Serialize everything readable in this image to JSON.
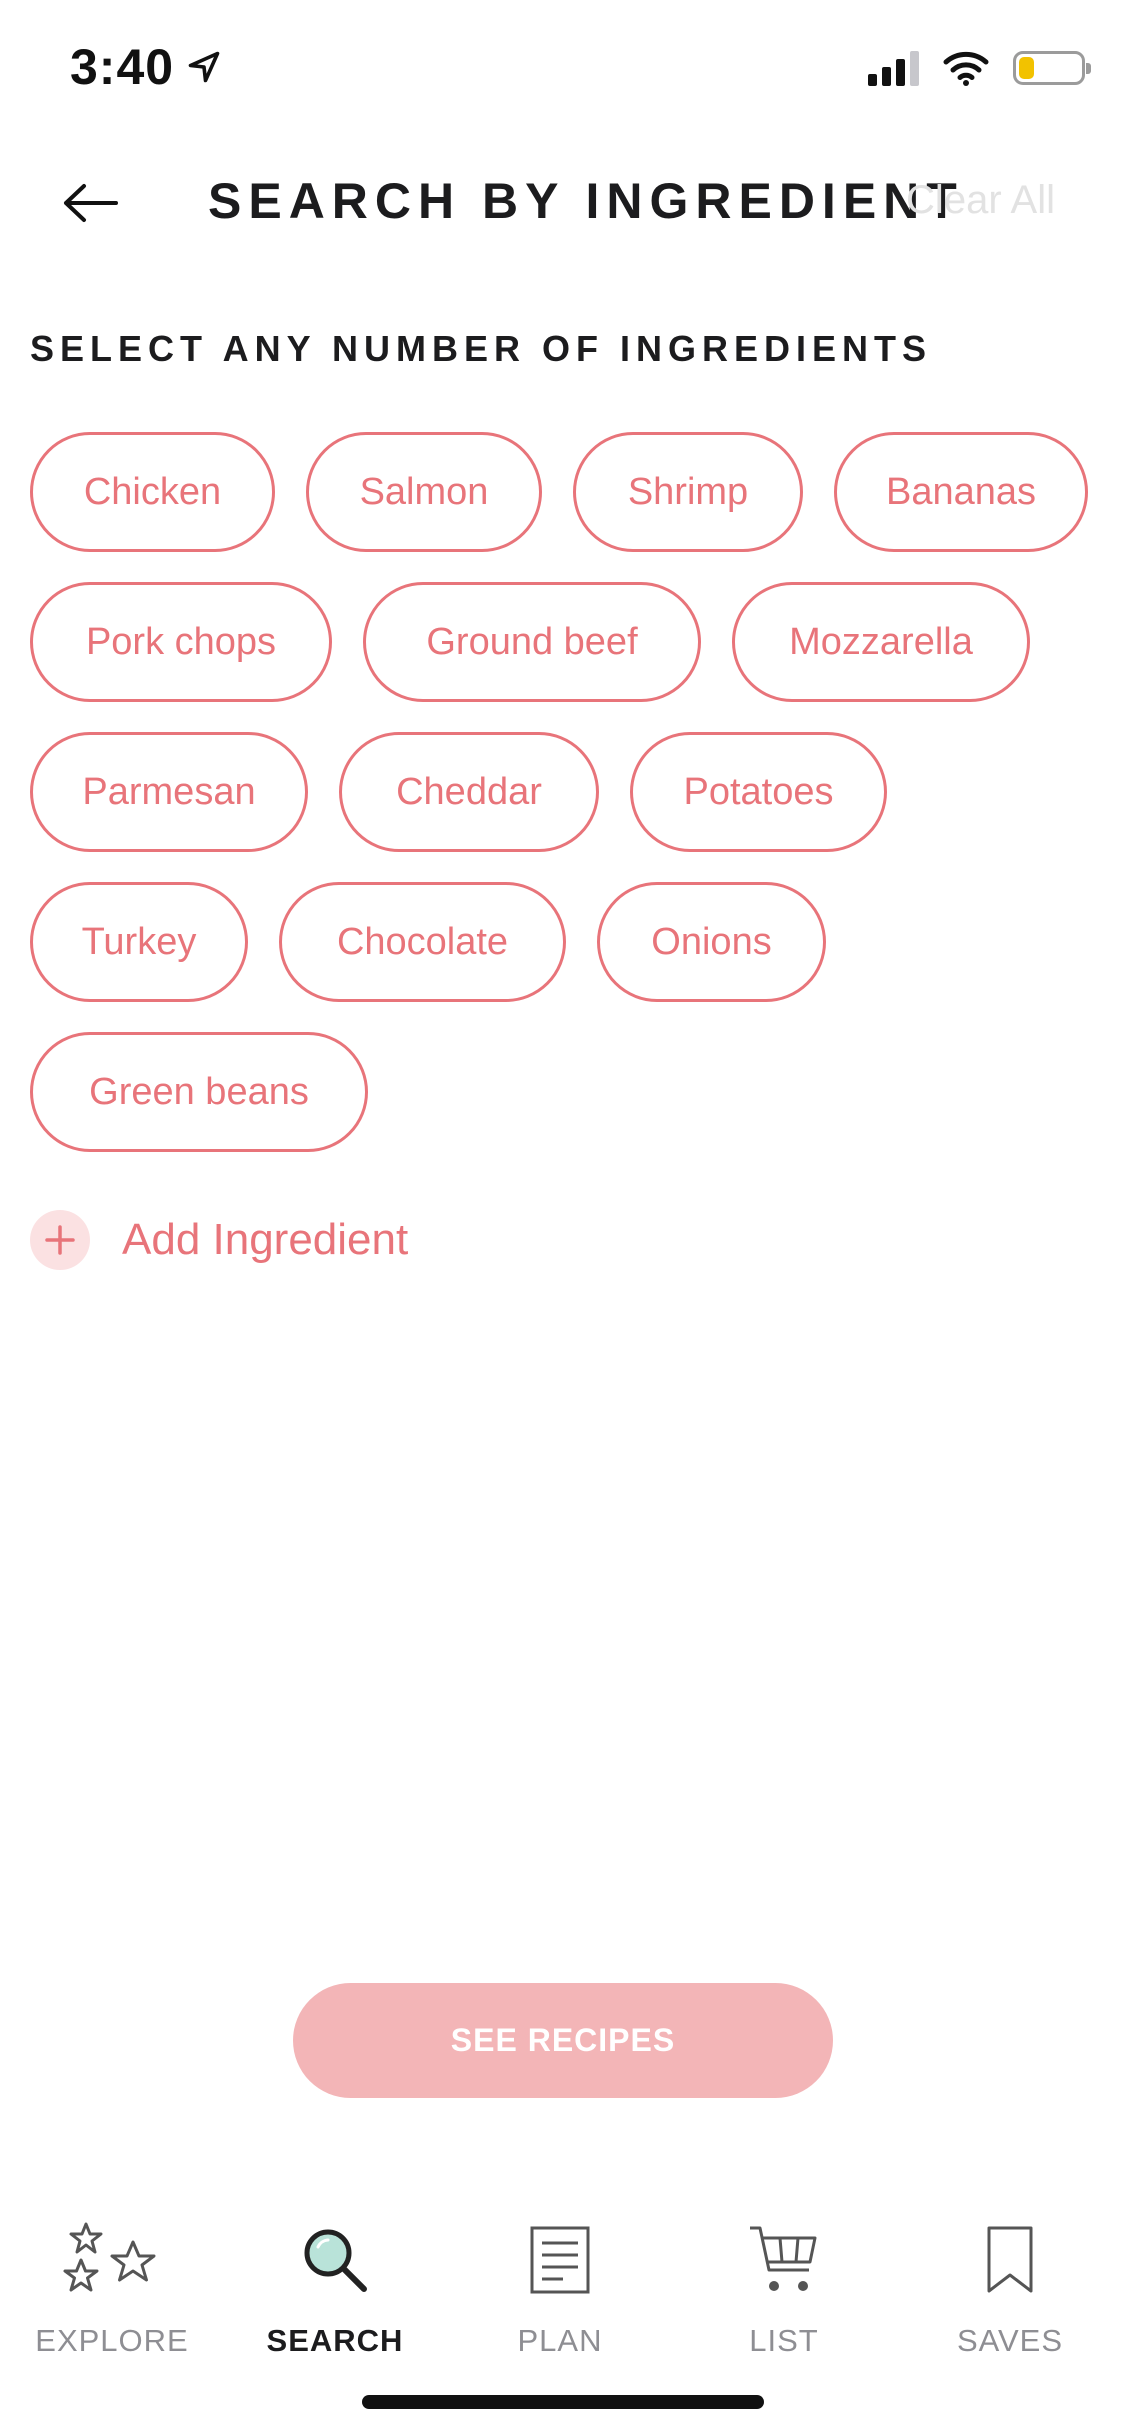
{
  "status_bar": {
    "time": "3:40",
    "battery_level": 0.25,
    "signal_bars": 4,
    "signal_bars_active": 3
  },
  "header": {
    "title": "SEARCH BY INGREDIENT",
    "clear_all": "Clear All",
    "back_icon": "arrow-left-icon"
  },
  "section_label": "SELECT ANY NUMBER OF INGREDIENTS",
  "ingredients": [
    "Chicken",
    "Salmon",
    "Shrimp",
    "Bananas",
    "Pork chops",
    "Ground beef",
    "Mozzarella",
    "Parmesan",
    "Cheddar",
    "Potatoes",
    "Turkey",
    "Chocolate",
    "Onions",
    "Green beans"
  ],
  "add_ingredient": {
    "label": "Add Ingredient",
    "icon": "plus-icon"
  },
  "see_recipes": "SEE RECIPES",
  "tabs": [
    {
      "label": "EXPLORE",
      "icon": "stars-icon",
      "active": false
    },
    {
      "label": "SEARCH",
      "icon": "search-icon",
      "active": true
    },
    {
      "label": "PLAN",
      "icon": "document-icon",
      "active": false
    },
    {
      "label": "LIST",
      "icon": "cart-icon",
      "active": false
    },
    {
      "label": "SAVES",
      "icon": "bookmark-icon",
      "active": false
    }
  ],
  "colors": {
    "accent": "#e8747a",
    "accent_light": "#fbe1e2",
    "button_disabled": "#f3b5b7",
    "search_lens": "#b9e3d9"
  }
}
